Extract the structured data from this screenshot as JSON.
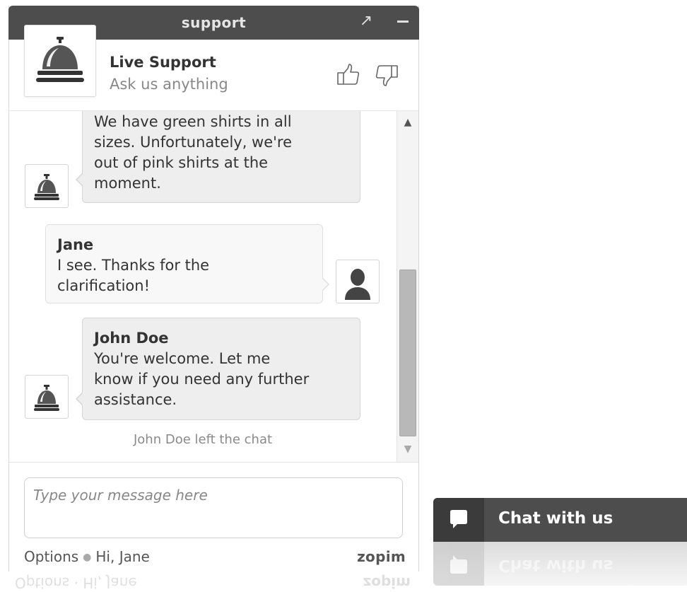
{
  "window": {
    "title": "support",
    "popout_icon": "popout-arrow-icon",
    "minimize_icon": "minimize-icon"
  },
  "header": {
    "name": "Live Support",
    "tagline": "Ask us anything",
    "avatar_icon": "service-bell-icon",
    "rate_good_icon": "thumbs-up-icon",
    "rate_bad_icon": "thumbs-down-icon"
  },
  "messages": [
    {
      "sender": "",
      "role": "agent",
      "lines": [
        "We have green shirts in all",
        "sizes. Unfortunately, we're",
        "out of pink shirts at the",
        "moment."
      ]
    },
    {
      "sender": "Jane",
      "role": "visitor",
      "lines": [
        "I see. Thanks for the",
        "clarification!"
      ]
    },
    {
      "sender": "John Doe",
      "role": "agent",
      "lines": [
        "You're welcome. Let me",
        "know if you need any further",
        "assistance."
      ]
    }
  ],
  "system_message": "John Doe left the chat",
  "composer": {
    "placeholder": "Type your message here",
    "options_label": "Options",
    "greeting": "Hi, Jane",
    "brand": "zopim"
  },
  "launcher": {
    "label": "Chat with us",
    "icon": "speech-bubble-icon"
  },
  "colors": {
    "title_bar": "#4d4d4d",
    "agent_bubble": "#eeeeee",
    "visitor_bubble": "#f8f8f8"
  }
}
